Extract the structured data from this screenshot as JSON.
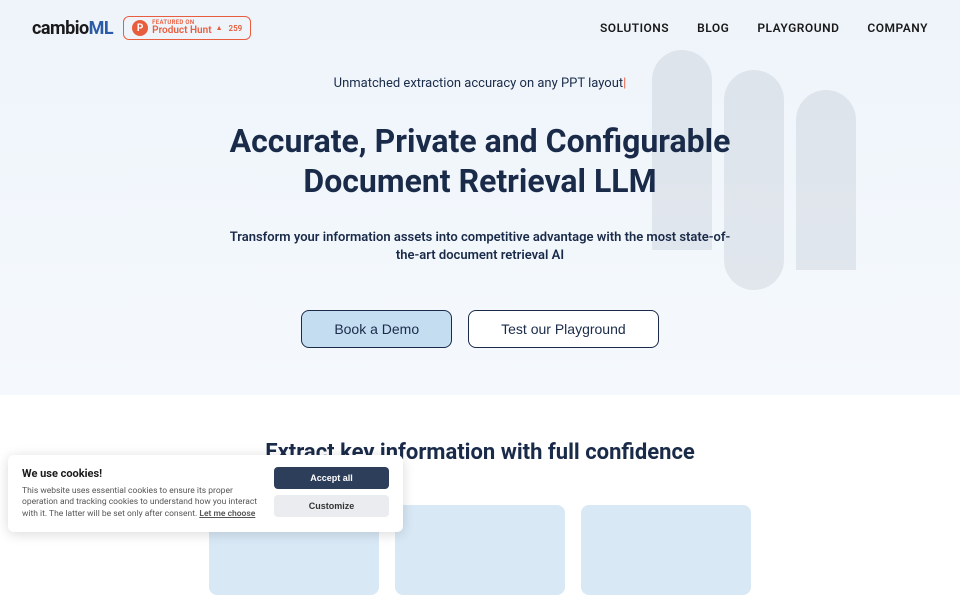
{
  "logo": {
    "part1": "cambio",
    "part2": "ML"
  },
  "productHunt": {
    "featured": "FEATURED ON",
    "name": "Product Hunt",
    "count": "259"
  },
  "nav": {
    "items": [
      "SOLUTIONS",
      "BLOG",
      "PLAYGROUND",
      "COMPANY"
    ]
  },
  "hero": {
    "tagline": "Unmatched extraction accuracy on any PPT layout",
    "headline_l1": "Accurate, Private and Configurable",
    "headline_l2": "Document Retrieval LLM",
    "subheadline": "Transform your information assets into competitive advantage with the most state-of-the-art document retrieval AI",
    "cta_primary": "Book a Demo",
    "cta_secondary": "Test our Playground"
  },
  "section2": {
    "title": "Extract key information with full confidence"
  },
  "cookies": {
    "title": "We use cookies!",
    "desc_part1": "This website uses essential cookies to ensure its proper operation and tracking cookies to understand how you interact with it. The latter will be set only after consent. ",
    "link": "Let me choose",
    "accept": "Accept all",
    "customize": "Customize"
  }
}
